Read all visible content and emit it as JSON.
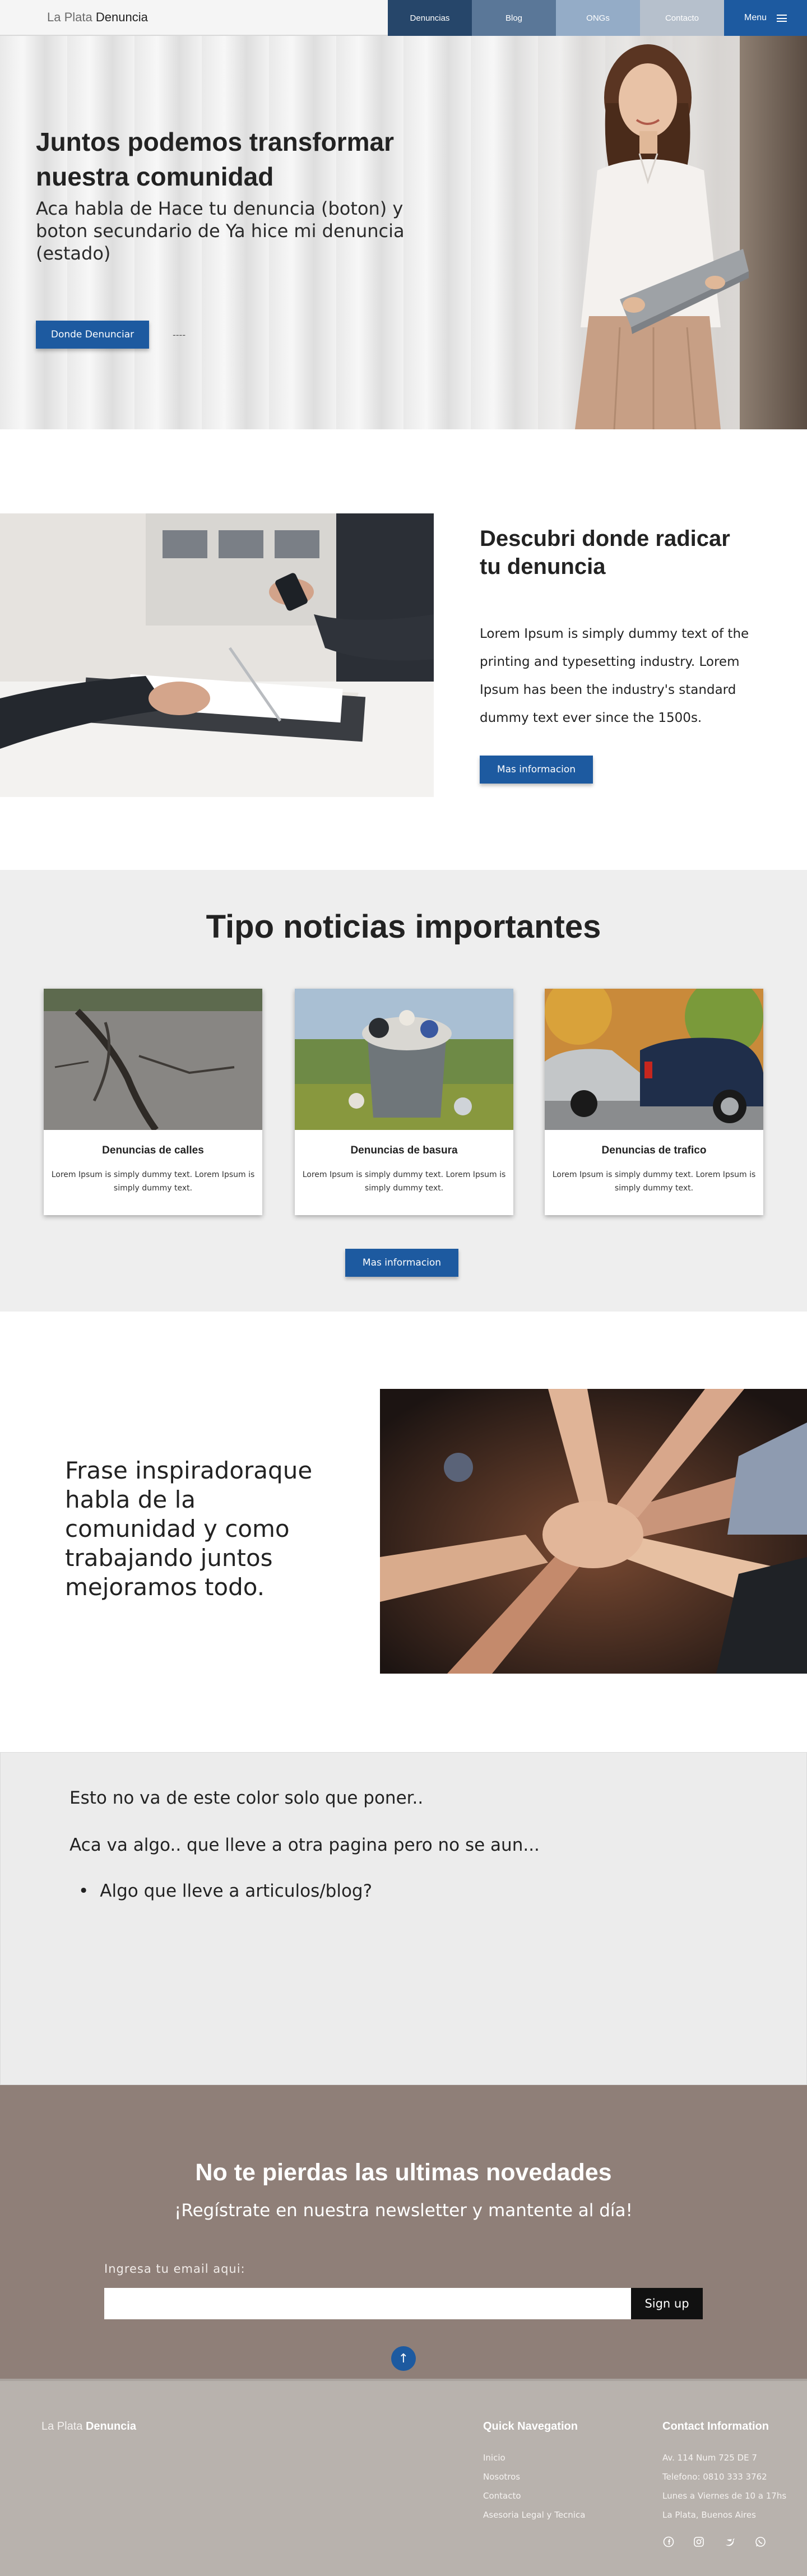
{
  "header": {
    "logo_prefix": "La Plata",
    "logo_bold": "Denuncia",
    "nav": [
      "Denuncias",
      "Blog",
      "ONGs",
      "Contacto"
    ],
    "menu_label": "Menu"
  },
  "hero": {
    "title": "Juntos podemos transformar nuestra comunidad",
    "subtitle": "Aca habla de Hace tu denuncia (boton) y boton secundario de Ya hice mi denuncia (estado)",
    "button": "Donde Denunciar",
    "secondary": "----"
  },
  "section2": {
    "title": "Descubri donde radicar tu denuncia",
    "text": "Lorem Ipsum is simply dummy text of the printing and typesetting industry. Lorem Ipsum has been the industry's standard dummy text ever since the 1500s.",
    "button": "Mas informacion"
  },
  "section3": {
    "title": "Tipo noticias importantes",
    "cards": [
      {
        "title": "Denuncias de calles",
        "text": "Lorem Ipsum is simply dummy text. Lorem Ipsum is simply dummy text."
      },
      {
        "title": "Denuncias de basura",
        "text": "Lorem Ipsum is simply dummy text. Lorem Ipsum is simply dummy text."
      },
      {
        "title": "Denuncias de trafico",
        "text": "Lorem Ipsum is simply dummy text. Lorem Ipsum is simply dummy text."
      }
    ],
    "button": "Mas informacion"
  },
  "section4": {
    "text": "Frase inspiradoraque habla de la comunidad y como trabajando juntos mejoramos todo."
  },
  "section5": {
    "line1": "Esto no va de este color solo que poner..",
    "line2": "Aca va algo.. que lleve a otra pagina pero no se aun...",
    "bullet": "Algo que lleve a articulos/blog?"
  },
  "newsletter": {
    "title": "No te pierdas las ultimas novedades",
    "subtitle": "¡Regístrate en nuestra newsletter y mantente al día!",
    "label": "Ingresa tu email aqui:",
    "button": "Sign up"
  },
  "footer": {
    "logo_prefix": "La Plata",
    "logo_bold": "Denuncia",
    "quick_title": "Quick Navegation",
    "quick_links": [
      "Inicio",
      "Nosotros",
      "Contacto",
      "Asesoria Legal y Tecnica"
    ],
    "contact_title": "Contact Information",
    "contact_lines": [
      "Av. 114 Num 725 DE 7",
      "Telefono: 0810 333 3762",
      "Lunes a Viernes de 10 a 17hs",
      "La Plata, Buenos Aires"
    ]
  },
  "colors": {
    "primary": "#1d5aa0",
    "newsletter_bg": "#8f7f78",
    "footer_bg": "#b8b2ad"
  },
  "icons": [
    "hamburger-icon",
    "arrow-up-icon",
    "facebook-icon",
    "instagram-icon",
    "twitter-icon",
    "whatsapp-icon"
  ]
}
